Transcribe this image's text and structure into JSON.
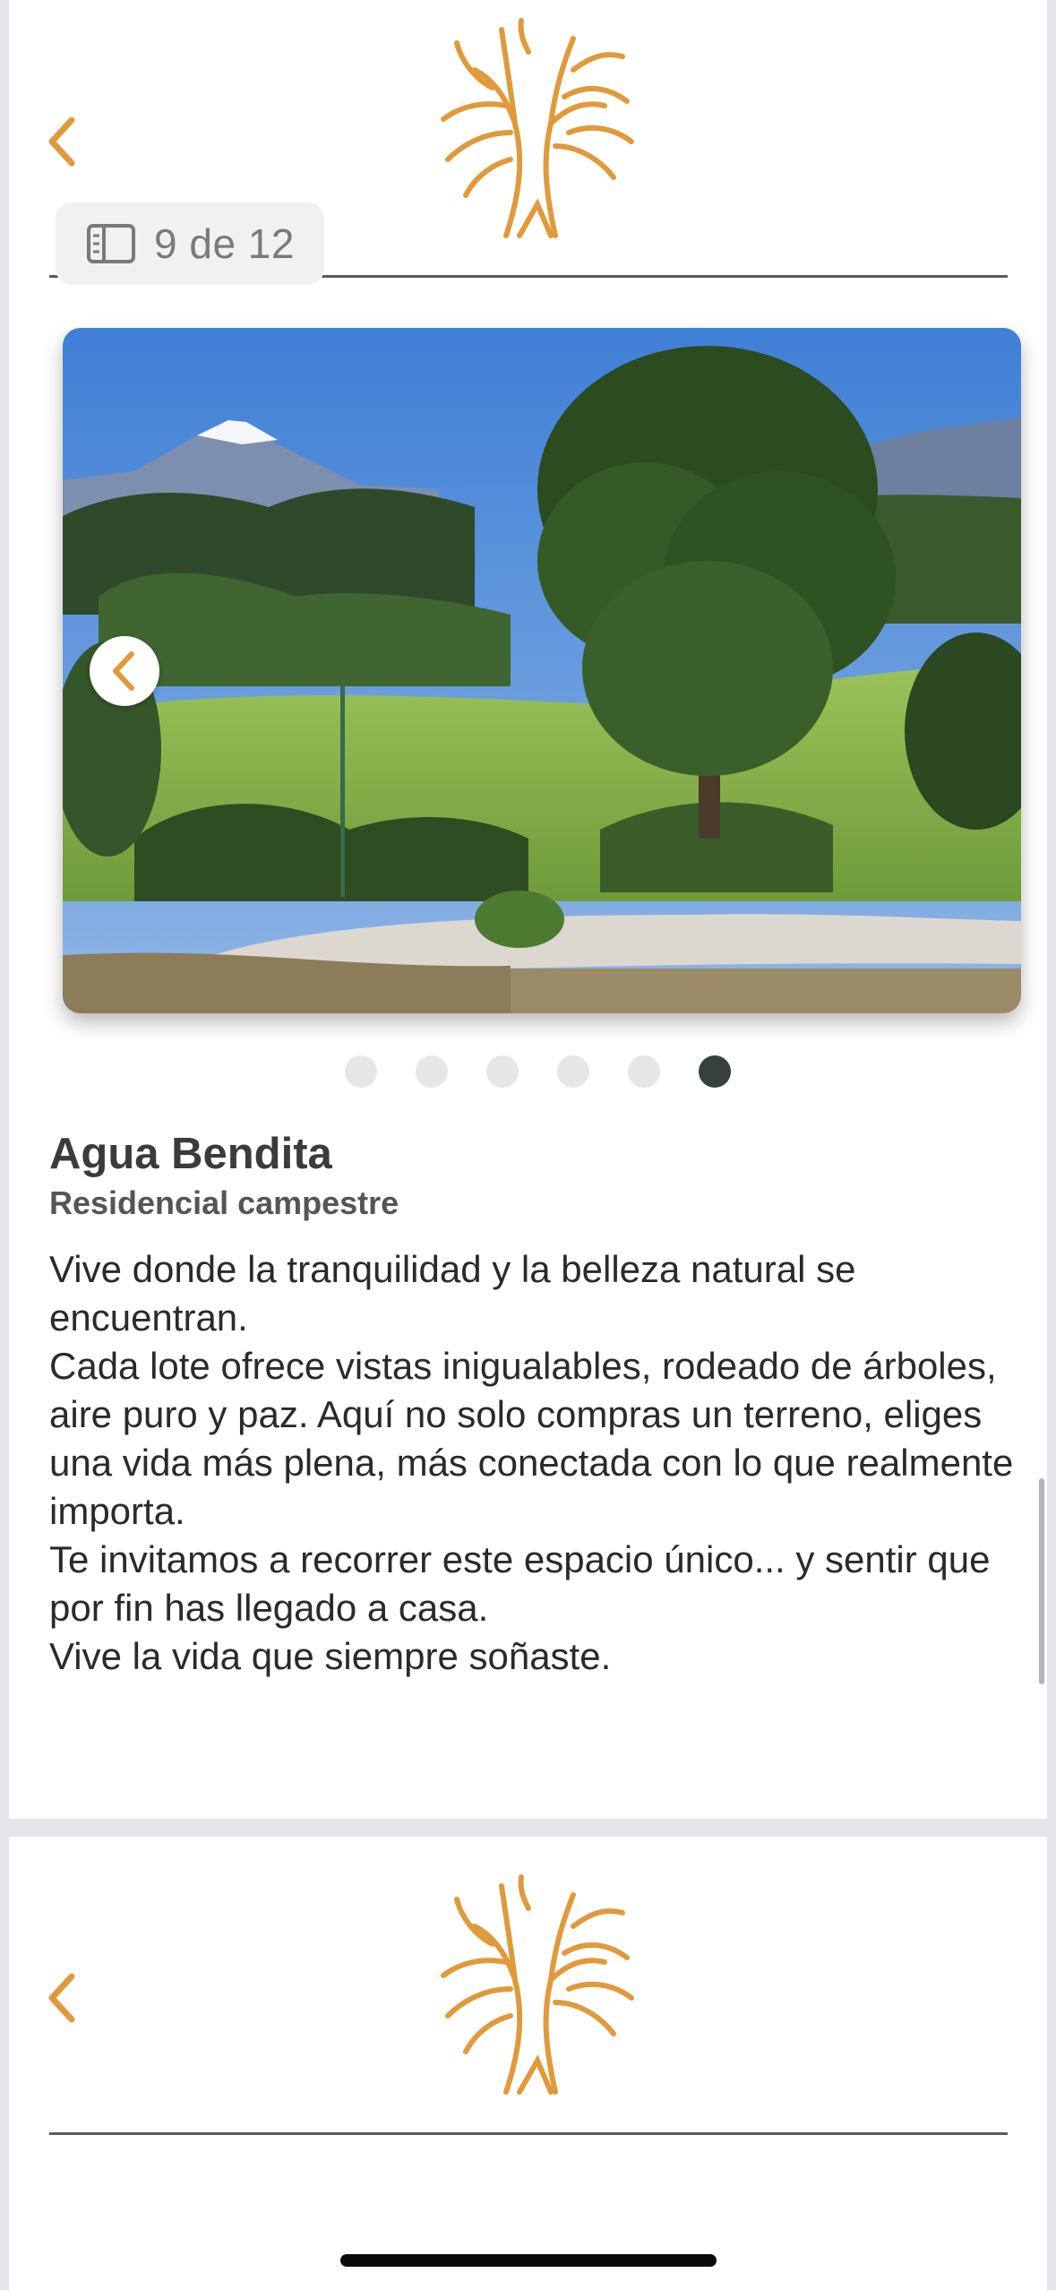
{
  "colors": {
    "accent": "#e09a3c",
    "dot_active": "#38403f",
    "dot_inactive": "#e6e6e6"
  },
  "header": {
    "back_icon": "chevron-left-icon",
    "logo_icon": "tree-logo-icon",
    "page_counter": {
      "icon": "book-pages-icon",
      "text": "9 de 12"
    }
  },
  "carousel": {
    "prev_icon": "chevron-left-icon",
    "slide_count": 6,
    "active_index": 5
  },
  "property": {
    "title": "Agua Bendita",
    "subtitle": "Residencial campestre",
    "description": "Vive donde la tranquilidad y la belleza natural se encuentran.\n Cada lote ofrece vistas inigualables, rodeado de árboles, aire puro y paz. Aquí no solo compras un terreno, eliges una vida más plena, más conectada con lo que realmente importa.\n Te invitamos a recorrer este espacio único... y sentir que por fin has llegado a casa.\nVive la vida que siempre soñaste."
  },
  "next_page": {
    "back_icon": "chevron-left-icon",
    "logo_icon": "tree-logo-icon"
  }
}
